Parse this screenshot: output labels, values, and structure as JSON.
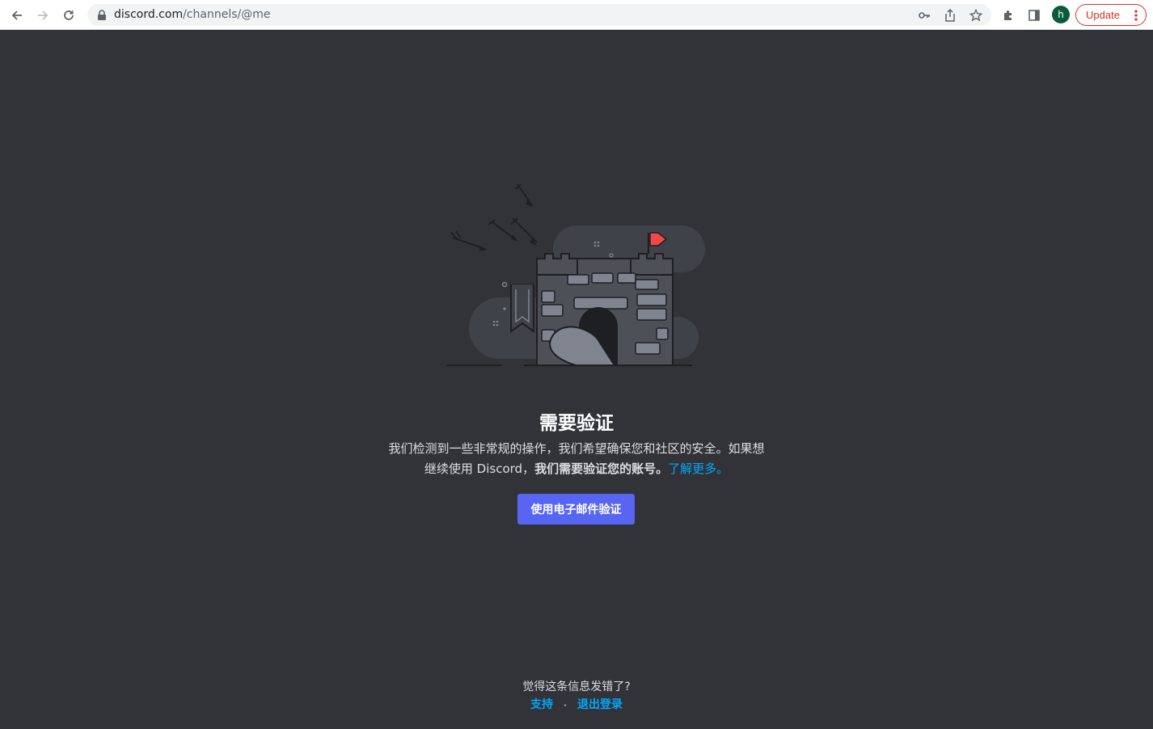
{
  "browser": {
    "url_host": "discord.com",
    "url_path": "/channels/@me",
    "avatar_letter": "h",
    "update_label": "Update",
    "icons": [
      "back-icon",
      "forward-icon",
      "reload-icon",
      "lock-icon",
      "key-icon",
      "share-icon",
      "star-icon",
      "extensions-icon",
      "side-panel-icon",
      "more-icon"
    ]
  },
  "page": {
    "title": "需要验证",
    "desc_line1": "我们检测到一些非常规的操作，我们希望确保您和社区的安全。如果想",
    "desc_line2_pre": "继续使用 Discord，",
    "desc_line2_strong": "我们需要验证您的账号。",
    "learn_more": "了解更多。",
    "verify_button": "使用电子邮件验证",
    "footer_question": "觉得这条信息发错了?",
    "support_link": "支持",
    "separator": "•",
    "logout_link": "退出登录"
  },
  "colors": {
    "background": "#313338",
    "brand": "#5865f2",
    "link": "#00a8fc",
    "flag": "#f04747"
  }
}
